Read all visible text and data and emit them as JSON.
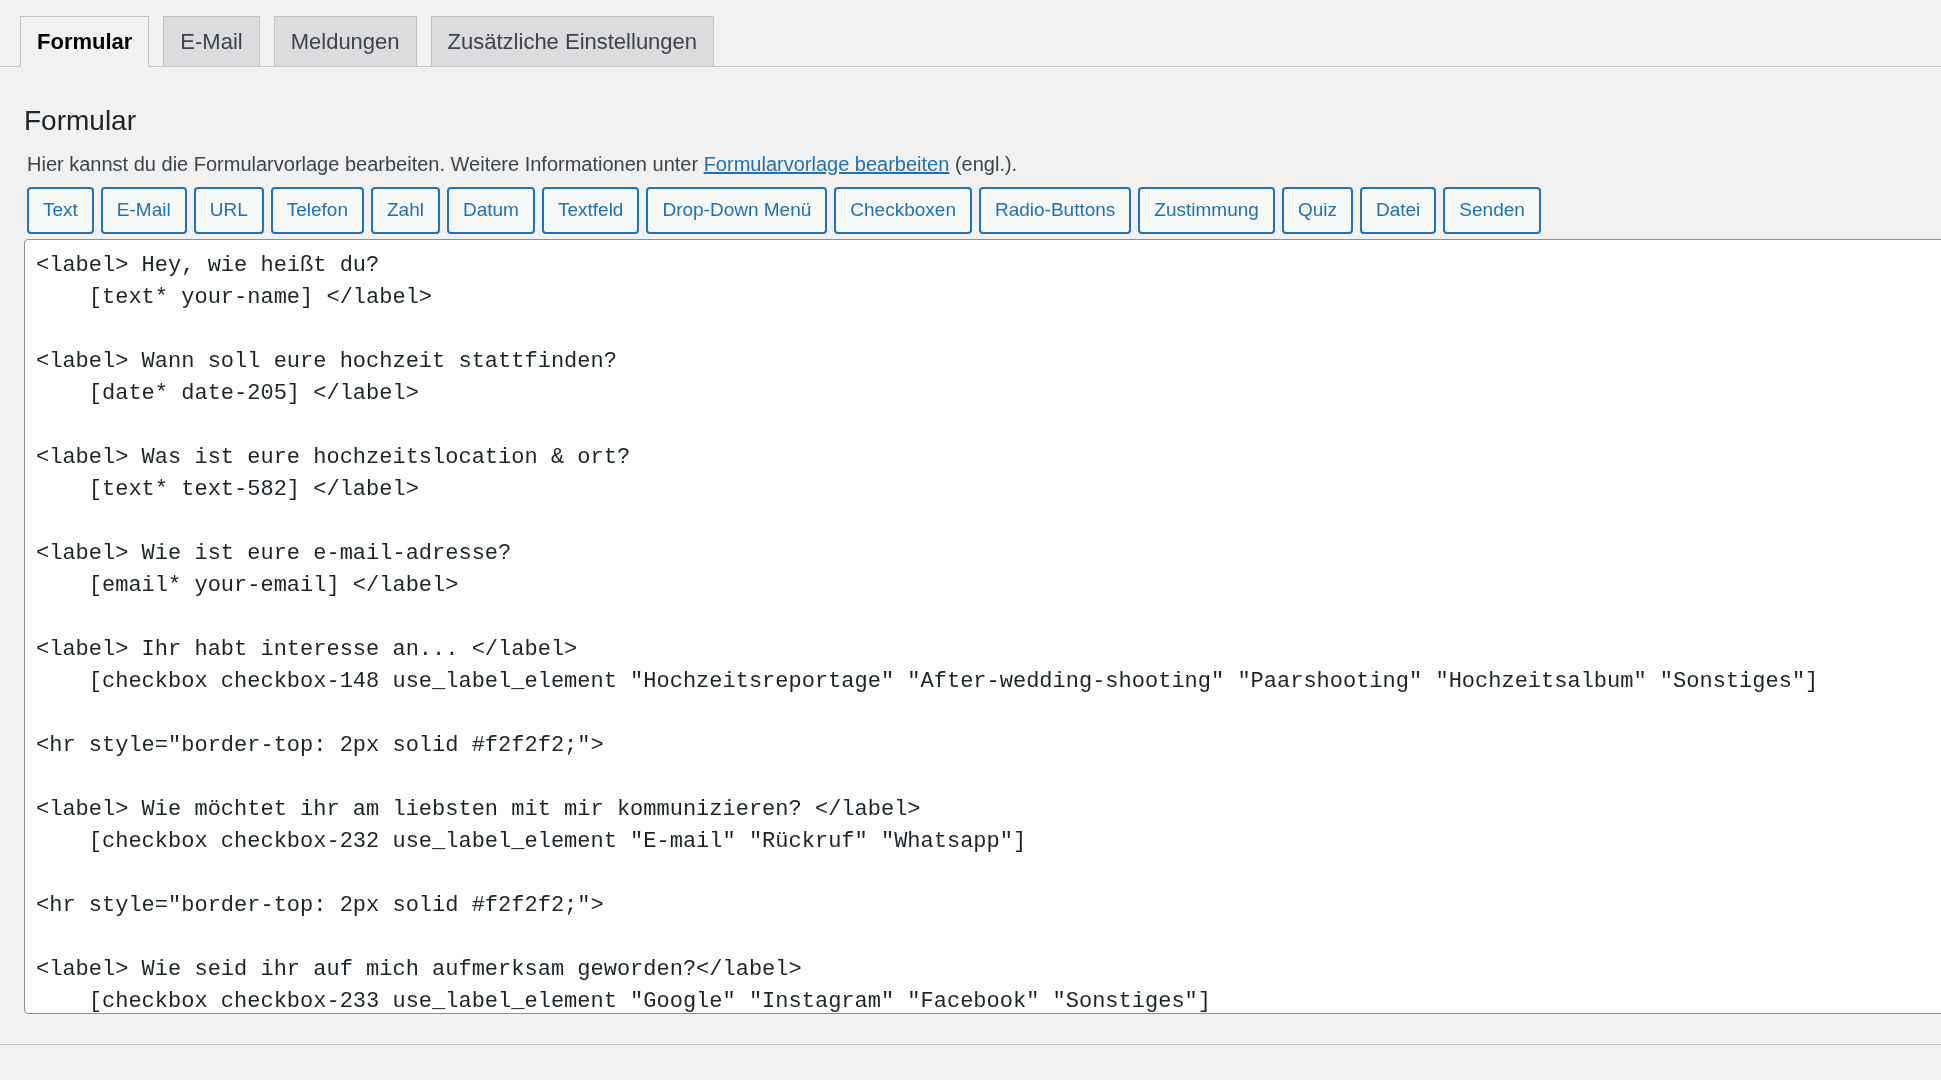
{
  "tabs": [
    {
      "label": "Formular",
      "selected": true
    },
    {
      "label": "E-Mail",
      "selected": false
    },
    {
      "label": "Meldungen",
      "selected": false
    },
    {
      "label": "Zusätzliche Einstellungen",
      "selected": false
    }
  ],
  "section": {
    "title": "Formular",
    "description": "Hier kannst du die Formularvorlage bearbeiten. Weitere Informationen unter",
    "link": "Formularvorlage bearbeiten",
    "suffix": "(engl.)."
  },
  "tag_buttons": [
    "Text",
    "E-Mail",
    "URL",
    "Telefon",
    "Zahl",
    "Datum",
    "Textfeld",
    "Drop-Down Menü",
    "Checkboxen",
    "Radio-Buttons",
    "Zustimmung",
    "Quiz",
    "Datei",
    "Senden"
  ],
  "editor": {
    "blocks": [
      [
        "<label> Hey, wie heißt du?",
        "    [text* your-name] </label>"
      ],
      [
        "<label> Wann soll eure hochzeit stattfinden?",
        "    [date* date-205] </label>"
      ],
      [
        "<label> Was ist eure hochzeitslocation & ort?",
        "    [text* text-582] </label>"
      ],
      [
        "<label> Wie ist eure e-mail-adresse?",
        "    [email* your-email] </label>"
      ],
      [
        "<label> Ihr habt interesse an... </label>",
        "    [checkbox checkbox-148 use_label_element \"Hochzeitsreportage\" \"After-wedding-shooting\" \"Paarshooting\" \"Hochzeitsalbum\" \"Sonstiges\"]"
      ],
      [
        "<hr style=\"border-top: 2px solid #f2f2f2;\">"
      ],
      [
        "<label> Wie möchtet ihr am liebsten mit mir kommunizieren? </label>",
        "    [checkbox checkbox-232 use_label_element \"E-mail\" \"Rückruf\" \"Whatsapp\"]"
      ],
      [
        "<hr style=\"border-top: 2px solid #f2f2f2;\">"
      ],
      [
        "<label> Wie seid ihr auf mich aufmerksam geworden?</label>",
        "    [checkbox checkbox-233 use_label_element \"Google\" \"Instagram\" \"Facebook\" \"Sonstiges\"]"
      ]
    ]
  }
}
